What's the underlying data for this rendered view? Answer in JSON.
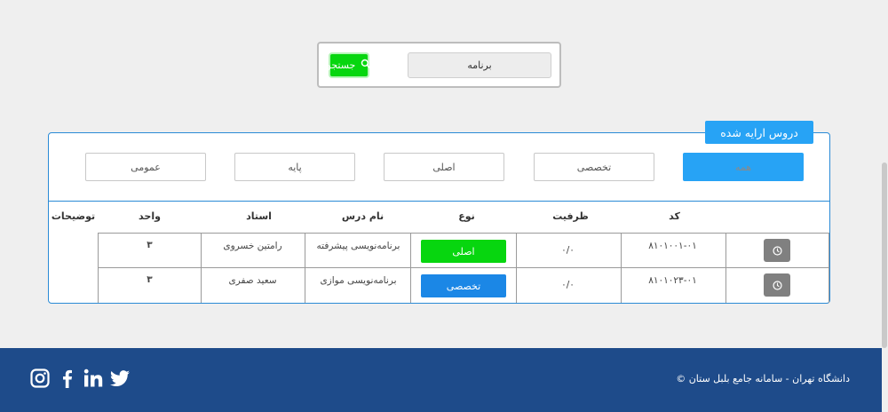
{
  "search": {
    "value": "برنامه",
    "button_label": "جستجو"
  },
  "panel": {
    "legend": "دروس ارایه شده",
    "filters": [
      "همه",
      "تخصصی",
      "اصلی",
      "پایه",
      "عمومی"
    ]
  },
  "table": {
    "headers": [
      "کد",
      "ظرفیت",
      "نوع",
      "نام درس",
      "استاد",
      "واحد",
      "توضیحات"
    ],
    "rows": [
      {
        "code": "۸۱۰۱۰۰۱-۰۱",
        "capacity": "۰/۰",
        "type": "اصلی",
        "type_color": "#07d60f",
        "name": "برنامه‌نویسی پیشرفته",
        "teacher": "رامتین خسروی",
        "units": "۳",
        "notes": ""
      },
      {
        "code": "۸۱۰۱۰۲۳-۰۱",
        "capacity": "۰/۰",
        "type": "تخصصی",
        "type_color": "#1b87e6",
        "name": "برنامه‌نویسی موازی",
        "teacher": "سعید صفری",
        "units": "۳",
        "notes": ""
      }
    ]
  },
  "footer": {
    "copyright": "© دانشگاه تهران - سامانه جامع بلبل ستان",
    "social": [
      "twitter-icon",
      "linkedin-icon",
      "facebook-icon",
      "instagram-icon"
    ]
  },
  "colors": {
    "accent": "#27a3f5",
    "success": "#07d60f",
    "footer": "#1e4b8a"
  }
}
